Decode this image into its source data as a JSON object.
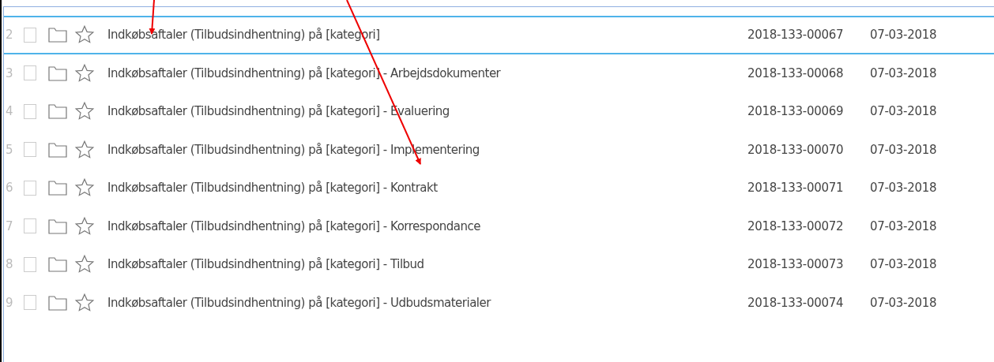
{
  "rows": [
    {
      "number": "2",
      "title": "Indkøbsaftaler (Tilbudsindhentning) på [kategori]",
      "case_number": "2018-133-00067",
      "date": "07-03-2018",
      "selected": true,
      "checked": false
    },
    {
      "number": "3",
      "title": "Indkøbsaftaler (Tilbudsindhentning) på [kategori] - Arbejdsdokumenter",
      "case_number": "2018-133-00068",
      "date": "07-03-2018",
      "selected": false,
      "checked": false
    },
    {
      "number": "4",
      "title": "Indkøbsaftaler (Tilbudsindhentning) på [kategori] - Evaluering",
      "case_number": "2018-133-00069",
      "date": "07-03-2018",
      "selected": false,
      "checked": false
    },
    {
      "number": "5",
      "title": "Indkøbsaftaler (Tilbudsindhentning) på [kategori] - Implementering",
      "case_number": "2018-133-00070",
      "date": "07-03-2018",
      "selected": false,
      "checked": false
    },
    {
      "number": "6",
      "title": "Indkøbsaftaler (Tilbudsindhentning) på [kategori] - Kontrakt",
      "case_number": "2018-133-00071",
      "date": "07-03-2018",
      "selected": false,
      "checked": false
    },
    {
      "number": "7",
      "title": "Indkøbsaftaler (Tilbudsindhentning) på [kategori] - Korrespondance",
      "case_number": "2018-133-00072",
      "date": "07-03-2018",
      "selected": false,
      "checked": false
    },
    {
      "number": "8",
      "title": "Indkøbsaftaler (Tilbudsindhentning) på [kategori] - Tilbud",
      "case_number": "2018-133-00073",
      "date": "07-03-2018",
      "selected": false,
      "checked": false
    },
    {
      "number": "9",
      "title": "Indkøbsaftaler (Tilbudsindhentning) på [kategori] - Udbudsmaterialer",
      "case_number": "2018-133-00074",
      "date": "07-03-2018",
      "selected": false,
      "checked": false
    }
  ]
}
